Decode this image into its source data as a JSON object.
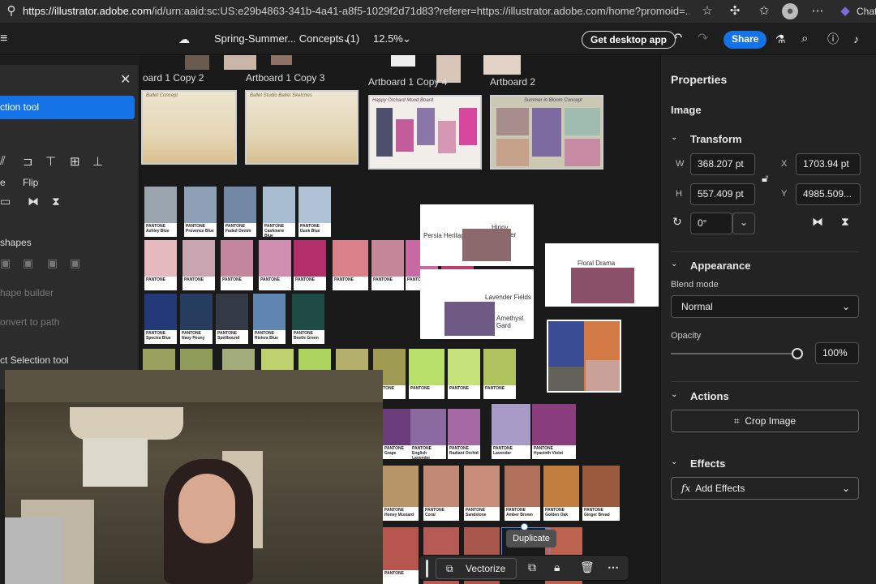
{
  "browser": {
    "url_host": "https://illustrator.adobe.com",
    "url_path": "/id/urn:aaid:sc:US:e29b4863-341b-4a41-a8f5-1029f2d71d83?referer=https://illustrator.adobe.com/home?promoid=...",
    "profile_label": "Chat"
  },
  "appbar": {
    "doc_title": "Spring-Summer... Concepts (1)",
    "zoom": "12.5%",
    "desktop_button": "Get desktop app",
    "share_button": "Share"
  },
  "left_panel": {
    "tool_name": "ction tool",
    "flip_label": "Flip",
    "shapes_heading": "shapes",
    "shape_builder": "hape builder",
    "convert_to_path": "onvert to path",
    "select_tool": "ct Selection tool",
    "partial_label": "e"
  },
  "artboards": {
    "labels": [
      "oard 1 Copy 2",
      "Artboard 1 Copy 3",
      "Artboard 1 Copy 4",
      "Artboard 2"
    ],
    "board_captions": [
      "Ballet Concept",
      "Ballet Studio Ballet Sketches",
      "Happy Orchard Mood Board",
      "Summer in Bloom Concept"
    ]
  },
  "moodboards": {
    "persia": "Persia Heritage",
    "hippy": "Hippy Summer",
    "lavender": "Lavender Fields",
    "amethyst": "Amethyst Gard",
    "floral": "Floral Drama"
  },
  "swatches": {
    "brand": "PANTONE",
    "row1": [
      "#9aa4af",
      "#8ea0b6",
      "#7288a5",
      "#a9bdd1",
      "#b0c2d6"
    ],
    "row1_names": [
      "Ashley Blue",
      "Provence Blue",
      "Faded Denim",
      "Cashmere Blue",
      "Dusk Blue"
    ],
    "row2": [
      "#e6b9bf",
      "#c9a4b1",
      "#c4869c",
      "#d08fb0",
      "#b32f6b",
      "#d98088",
      "#c58797",
      "#c76aa1",
      "#c23c70"
    ],
    "row3": [
      "#233a78",
      "#263d60",
      "#343a45",
      "#5e86b0",
      "#1f4b46"
    ],
    "row3_names": [
      "Spectra Blue",
      "Navy Peony",
      "Spellbound",
      "Riviera Blue",
      "Beetle Green"
    ],
    "row4": [
      "#97a05d",
      "#8f9c5a",
      "#a3ad7c",
      "#bdd16e",
      "#acd35e",
      "#b4b06c",
      "#9f9a52",
      "#b7df6a",
      "#c6e37b",
      "#aec35d"
    ],
    "row5": [
      "#6a3d7a",
      "#8a6aa0",
      "#a56aa3",
      "#a99bc8",
      "#8a3d7d"
    ],
    "row5_names": [
      "Grape",
      "English Lavender",
      "Radiant Orchid",
      "Lavender",
      "Hyacinth Violet"
    ],
    "row6": [
      "#b89567",
      "#c28a74",
      "#c98e7a",
      "#b0705a",
      "#c27e3e",
      "#9b5a3d"
    ],
    "row6_names": [
      "Honey Mustard",
      "Coral",
      "Sandstone",
      "Amber Brown",
      "Golden Oak",
      "Ginger Bread"
    ],
    "row7": [
      "#b6564f",
      "#b65a55",
      "#a9574d",
      "#bb6250"
    ]
  },
  "properties": {
    "title": "Properties",
    "object_type": "Image",
    "transform_label": "Transform",
    "w_label": "W",
    "h_label": "H",
    "x_label": "X",
    "y_label": "Y",
    "w_value": "368.207 pt",
    "h_value": "557.409 pt",
    "x_value": "1703.94 pt",
    "y_value": "4985.509...",
    "rotation": "0°",
    "appearance_label": "Appearance",
    "blend_mode_label": "Blend mode",
    "blend_mode": "Normal",
    "opacity_label": "Opacity",
    "opacity_value": "100%",
    "opacity_fraction": 1.0,
    "actions_label": "Actions",
    "crop_button": "Crop Image",
    "effects_label": "Effects",
    "add_effects": "Add Effects"
  },
  "context_bar": {
    "vectorize": "Vectorize",
    "tooltip": "Duplicate"
  },
  "colors": {
    "accent": "#1473e6",
    "panel_bg": "#232323",
    "canvas_bg": "#1a1a1a"
  }
}
